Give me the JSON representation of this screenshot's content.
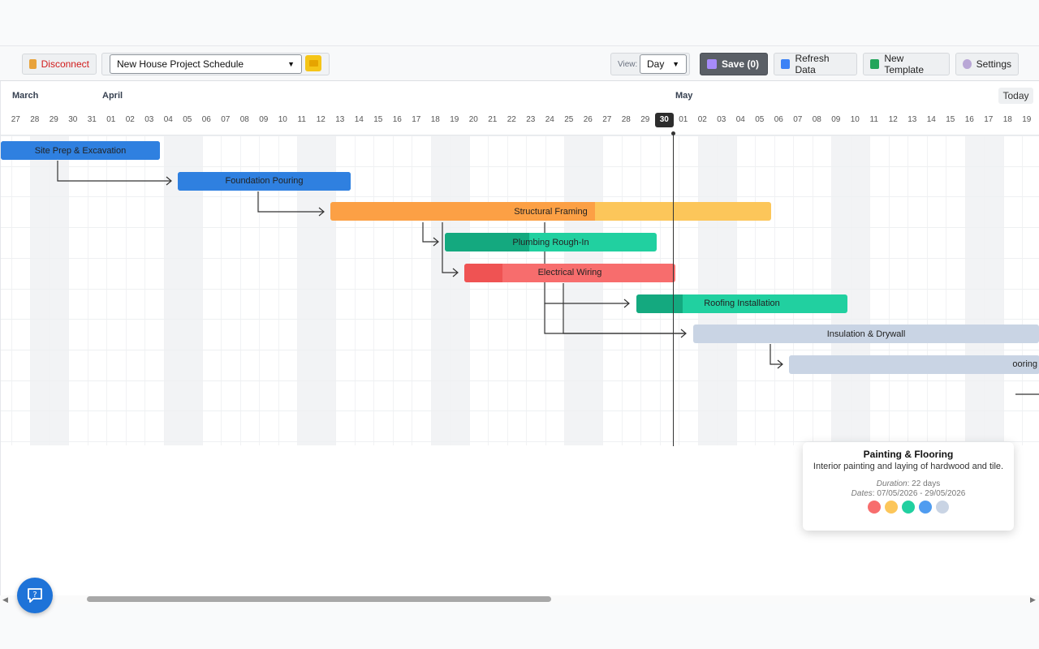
{
  "toolbar": {
    "disconnect_label": "Disconnect",
    "project_select": "New House Project Schedule",
    "view_label": "View:",
    "view_value": "Day",
    "save_label": "Save (0)",
    "refresh_label": "Refresh Data",
    "new_template_label": "New Template",
    "settings_label": "Settings"
  },
  "timeline": {
    "months": [
      "March",
      "April",
      "May"
    ],
    "today_label": "Today",
    "days": [
      "27",
      "28",
      "29",
      "30",
      "31",
      "01",
      "02",
      "03",
      "04",
      "05",
      "06",
      "07",
      "08",
      "09",
      "10",
      "11",
      "12",
      "13",
      "14",
      "15",
      "16",
      "17",
      "18",
      "19",
      "20",
      "21",
      "22",
      "23",
      "24",
      "25",
      "26",
      "27",
      "28",
      "29",
      "30",
      "01",
      "02",
      "03",
      "04",
      "05",
      "06",
      "07",
      "08",
      "09",
      "10",
      "11",
      "12",
      "13",
      "14",
      "15",
      "16",
      "17",
      "18",
      "19"
    ],
    "today_day": "30"
  },
  "tasks": [
    {
      "name": "Site Prep & Excavation",
      "color": "#2f80e0",
      "progress_color": "#2f80e0"
    },
    {
      "name": "Foundation Pouring",
      "color": "#2f80e0",
      "progress_color": "#2f80e0"
    },
    {
      "name": "Structural Framing",
      "color": "#fcc65a",
      "progress_color": "#fca045"
    },
    {
      "name": "Plumbing Rough-In",
      "color": "#21d0a0",
      "progress_color": "#14a97f"
    },
    {
      "name": "Electrical Wiring",
      "color": "#f76d6d",
      "progress_color": "#ef5353"
    },
    {
      "name": "Roofing Installation",
      "color": "#21d0a0",
      "progress_color": "#14a97f"
    },
    {
      "name": "Insulation & Drywall",
      "color": "#c9d4e4",
      "progress_color": "#c9d4e4"
    },
    {
      "name": "Painting & Flooring",
      "color": "#c9d4e4",
      "progress_color": "#c9d4e4",
      "visible_label": "ooring"
    }
  ],
  "popup": {
    "title": "Painting & Flooring",
    "description": "Interior painting and laying of hardwood and tile.",
    "duration_label": "Duration",
    "duration_value": ": 22 days",
    "dates_label": "Dates",
    "dates_value": ": 07/05/2026 - 29/05/2026",
    "swatch_colors": [
      "#f76d6d",
      "#fcc65a",
      "#21d0a0",
      "#4f9cf0",
      "#c9d4e4"
    ]
  },
  "icons": {
    "disconnect": "plug-icon",
    "folder": "folder-icon",
    "save": "floppy-icon",
    "refresh": "refresh-icon",
    "template": "grid-icon",
    "settings": "gear-icon",
    "help": "help-chat-icon"
  }
}
